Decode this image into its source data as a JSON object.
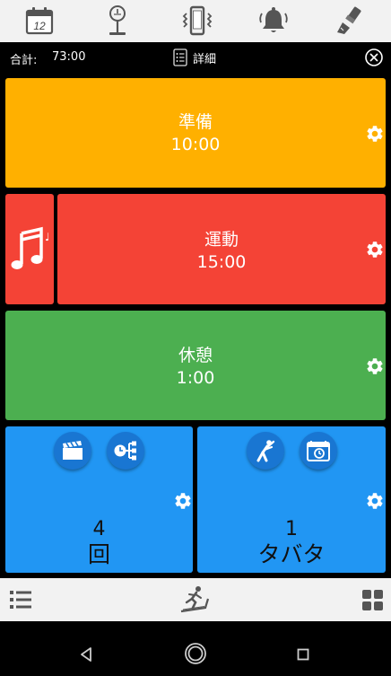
{
  "toolbar": {
    "icons": [
      "calendar-icon",
      "weight-scale-icon",
      "phone-vibrate-icon",
      "alarm-bell-icon",
      "brush-icon"
    ],
    "calendar_day": "12"
  },
  "summary": {
    "total_label": "合計:",
    "total_value": "73:00",
    "detail_label": "詳細"
  },
  "cards": {
    "prep": {
      "name": "準備",
      "time": "10:00",
      "color": "#ffb000"
    },
    "exercise": {
      "name": "運動",
      "time": "15:00",
      "color": "#f44336"
    },
    "rest": {
      "name": "休憩",
      "time": "1:00",
      "color": "#4caf50"
    },
    "rounds": {
      "count": "4",
      "unit": "回",
      "color": "#2196f3"
    },
    "tabata": {
      "count": "1",
      "unit": "タバタ",
      "color": "#2196f3"
    }
  },
  "bottom": {
    "icons": [
      "list-icon",
      "treadmill-runner-icon",
      "grid-icon"
    ]
  },
  "nav": {
    "icons": [
      "back-icon",
      "home-icon",
      "recents-icon"
    ]
  }
}
